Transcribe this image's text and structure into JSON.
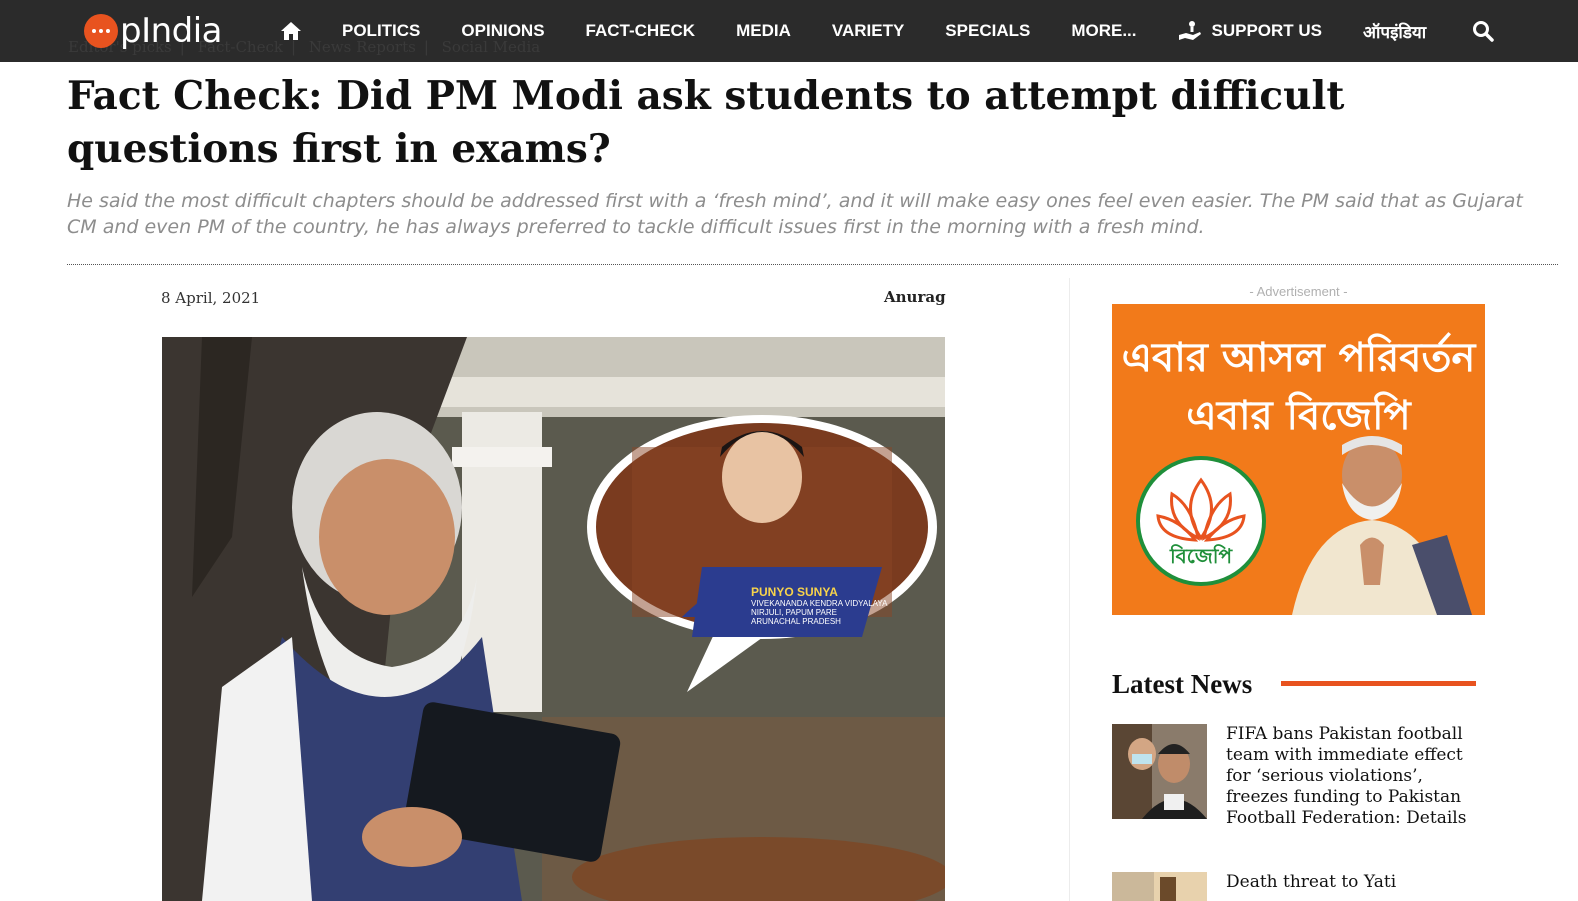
{
  "nav": {
    "logo_text": "pIndia",
    "items": [
      {
        "label": "POLITICS"
      },
      {
        "label": "OPINIONS"
      },
      {
        "label": "FACT-CHECK"
      },
      {
        "label": "MEDIA"
      },
      {
        "label": "VARIETY"
      },
      {
        "label": "SPECIALS"
      },
      {
        "label": "MORE..."
      }
    ],
    "support_label": "SUPPORT US",
    "hindi_label": "ऑपइंडिया",
    "icons": [
      "home-icon",
      "donate-hand-icon",
      "search-icon"
    ]
  },
  "breadcrumb": [
    "Editor's picks",
    "Fact-Check",
    "News Reports",
    "Social Media"
  ],
  "article": {
    "title": "Fact Check: Did PM Modi ask students to attempt difficult questions first in exams?",
    "subtitle": "He said the most difficult chapters should be addressed first with a ‘fresh mind’, and it will make easy ones feel even easier. The PM said that as Gujarat CM and even PM of the country, he has always preferred to tackle difficult issues first in the morning with a fresh mind.",
    "date": "8 April, 2021",
    "author": "Anurag",
    "hero_caption": {
      "name": "PUNYO SUNYA",
      "line1": "VIVEKANANDA KENDRA VIDYALAYA",
      "line2": "NIRJULI, PAPUM PARE",
      "line3": "ARUNACHAL PRADESH"
    }
  },
  "sidebar": {
    "ad_label": "- Advertisement -",
    "ad_line1": "এবার আসল পরিবর্তন",
    "ad_line2": "এবার বিজেপি",
    "ad_logo_text": "বিজেপি",
    "latest_news_title": "Latest News",
    "news": [
      {
        "title": "FIFA bans Pakistan football team with immediate effect for ‘serious violations’, freezes funding to Pakistan Football Federation: Details"
      },
      {
        "title": "Death threat to Yati"
      }
    ]
  },
  "colors": {
    "nav_bg": "#2b2b2b",
    "accent": "#e8531f",
    "ad_bg": "#f27a1a"
  }
}
